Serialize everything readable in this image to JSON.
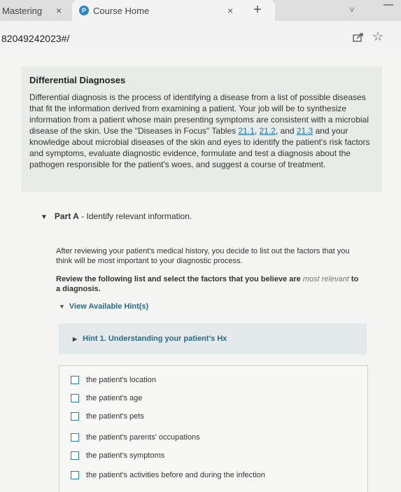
{
  "browser": {
    "tabs": [
      {
        "title": "Mastering"
      },
      {
        "title": "Course Home",
        "favicon": "P"
      }
    ],
    "url": "82049242023#/",
    "icons": {
      "close": "×",
      "new_tab": "+",
      "chevron": "v",
      "star": "☆"
    }
  },
  "intro": {
    "heading": "Differential Diagnoses",
    "text_before": "Differential diagnosis is the process of identifying a disease from a list of possible diseases that fit the information derived from examining a patient. Your job will be to synthesize information from a patient whose main presenting symptoms are consistent with a microbial disease of the skin. Use the \"Diseases in Focus\" Tables ",
    "link1": "21.1",
    "sep1": ", ",
    "link2": "21.2",
    "sep2": ", and ",
    "link3": "21.3",
    "text_after": " and your knowledge about microbial diseases of the skin and eyes to identify the patient's risk factors and symptoms, evaluate diagnostic evidence, formulate and test a diagnosis about the pathogen responsible for the patient's woes, and suggest a course of treatment."
  },
  "part": {
    "label": "Part A",
    "sep": " - ",
    "title": "Identify relevant information."
  },
  "question": {
    "para1": "After reviewing your patient's medical history, you decide to list out the factors that you think will be most important to your diagnostic process.",
    "para2_main": "Review the following list and select the factors that you believe are ",
    "para2_em": "most relevant",
    "para2_end": " to a diagnosis."
  },
  "hints": {
    "toggle": "View Available Hint(s)",
    "items": [
      "Hint 1. Understanding your patient's Hx"
    ]
  },
  "options": [
    "the patient's location",
    "the patient's age",
    "the patient's pets",
    "the patient's parents' occupations",
    "the patient's symptoms",
    "the patient's activities before and during the infection"
  ]
}
